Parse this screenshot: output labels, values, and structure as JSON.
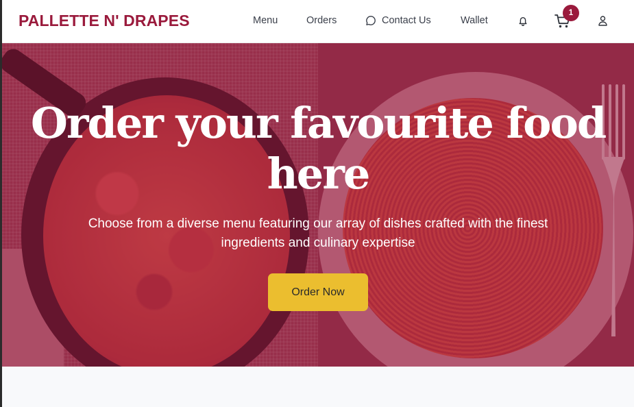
{
  "brand": {
    "name": "PALLETTE N' DRAPES",
    "color": "#9a1a3c"
  },
  "nav": {
    "items": [
      {
        "label": "Menu",
        "icon": ""
      },
      {
        "label": "Orders",
        "icon": ""
      },
      {
        "label": "Contact Us",
        "icon": "chat-bubble-icon"
      },
      {
        "label": "Wallet",
        "icon": ""
      }
    ],
    "icons": [
      "bell-icon",
      "cart-icon",
      "user-icon"
    ],
    "cart_count": "1",
    "badge_color": "#9a1a3c"
  },
  "hero": {
    "title": "Order your favourite food here",
    "subtitle": "Choose from a diverse menu featuring our array of dishes crafted with the finest ingredients and culinary expertise",
    "cta_label": "Order Now",
    "cta_color": "#ebbe2f",
    "overlay_color": "#96203f"
  }
}
